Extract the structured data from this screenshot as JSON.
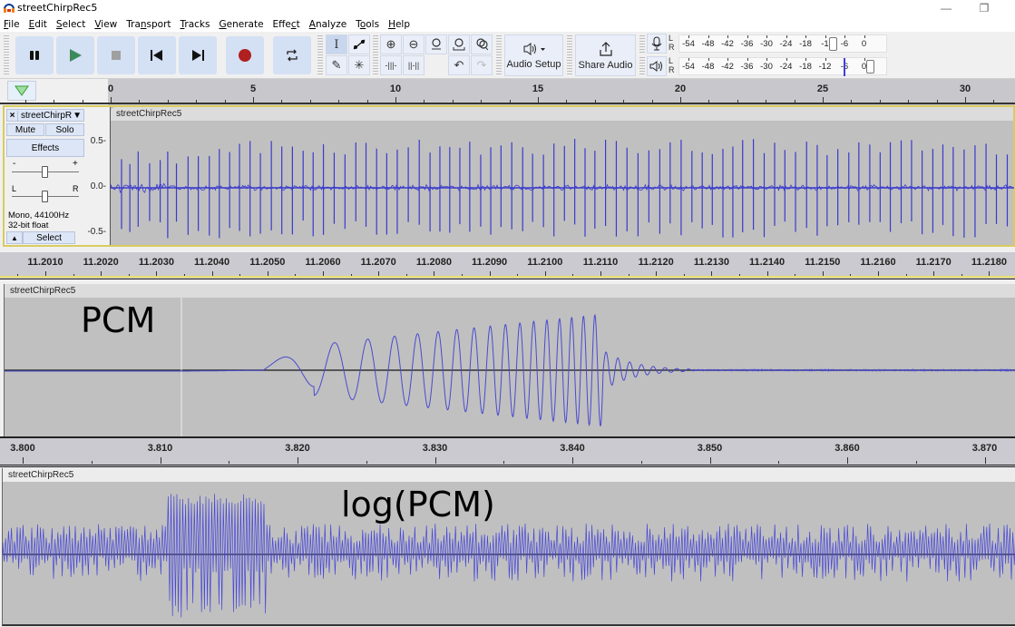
{
  "window": {
    "title": "streetChirpRec5",
    "minimize_glyph": "—",
    "restore_glyph": "❐"
  },
  "menu": [
    {
      "label": "File",
      "accel": "F"
    },
    {
      "label": "Edit",
      "accel": "E"
    },
    {
      "label": "Select",
      "accel": "S"
    },
    {
      "label": "View",
      "accel": "V"
    },
    {
      "label": "Transport",
      "accel": "n"
    },
    {
      "label": "Tracks",
      "accel": "T"
    },
    {
      "label": "Generate",
      "accel": "G"
    },
    {
      "label": "Effect",
      "accel": "c"
    },
    {
      "label": "Analyze",
      "accel": "A"
    },
    {
      "label": "Tools",
      "accel": "o"
    },
    {
      "label": "Help",
      "accel": "H"
    }
  ],
  "toolbar": {
    "transport": {
      "pause": "pause-icon",
      "play": "play-icon",
      "stop": "stop-icon",
      "skip_start": "skip-to-start-icon",
      "skip_end": "skip-to-end-icon",
      "record": "record-icon",
      "loop": "loop-icon"
    },
    "colors": {
      "play": "#3c8a5a",
      "record": "#b02020",
      "stop": "#a0a0a0",
      "button_bg": "#d4e0f4"
    },
    "tools": {
      "selection": "I",
      "envelope": "envelope-icon",
      "draw": "✎",
      "multi": "✳"
    },
    "edit": {
      "zoom_in": "⊕",
      "zoom_out": "⊖",
      "fit_selection": "fit-selection-icon",
      "fit_project": "fit-project-icon",
      "zoom_toggle": "zoom-toggle-icon",
      "trim": "-|||-",
      "silence": "||-||",
      "undo": "↶",
      "redo": "↷"
    },
    "audio_setup_label": "Audio Setup",
    "share_audio_label": "Share Audio",
    "record_meter": {
      "channels": [
        "L",
        "R"
      ],
      "ticks": [
        "-54",
        "-48",
        "-42",
        "-36",
        "-30",
        "-24",
        "-18",
        "-1",
        "-6",
        "0"
      ],
      "knob_after_tick": "-12"
    },
    "play_meter": {
      "channels": [
        "L",
        "R"
      ],
      "ticks": [
        "-54",
        "-48",
        "-42",
        "-36",
        "-30",
        "-24",
        "-18",
        "-12",
        "-6",
        "0"
      ],
      "level_db": -6
    }
  },
  "timeline": {
    "labels": [
      "0",
      "5",
      "10",
      "15",
      "20",
      "25",
      "30"
    ],
    "unit": "seconds"
  },
  "track": {
    "name": "streetChirpR",
    "clip_name": "streetChirpRec5",
    "close_label": "×",
    "menu_arrow": "▼",
    "mute_label": "Mute",
    "solo_label": "Solo",
    "effects_label": "Effects",
    "gain_minus": "-",
    "gain_plus": "+",
    "pan_left": "L",
    "pan_right": "R",
    "format_line1": "Mono, 44100Hz",
    "format_line2": "32-bit float",
    "collapse_arrow": "▲",
    "select_label": "Select",
    "scale_labels": [
      "0.5-",
      "0.0-",
      "-0.5-"
    ],
    "waveform_color": "#3a3acc"
  },
  "zoom_ruler": {
    "labels": [
      "00",
      "11.2010",
      "11.2020",
      "11.2030",
      "11.2040",
      "11.2050",
      "11.2060",
      "11.2070",
      "11.2080",
      "11.2090",
      "11.2100",
      "11.2110",
      "11.2120",
      "11.2130",
      "11.2140",
      "11.2150",
      "11.2160",
      "11.2170",
      "11.2180"
    ]
  },
  "pcm_panel": {
    "clip_name": "streetChirpRec5",
    "annotation": "PCM"
  },
  "pcm_ruler": {
    "labels": [
      "3.800",
      "3.810",
      "3.820",
      "3.830",
      "3.840",
      "3.850",
      "3.860",
      "3.870"
    ]
  },
  "log_panel": {
    "clip_name": "streetChirpRec5",
    "annotation": "log(PCM)"
  }
}
